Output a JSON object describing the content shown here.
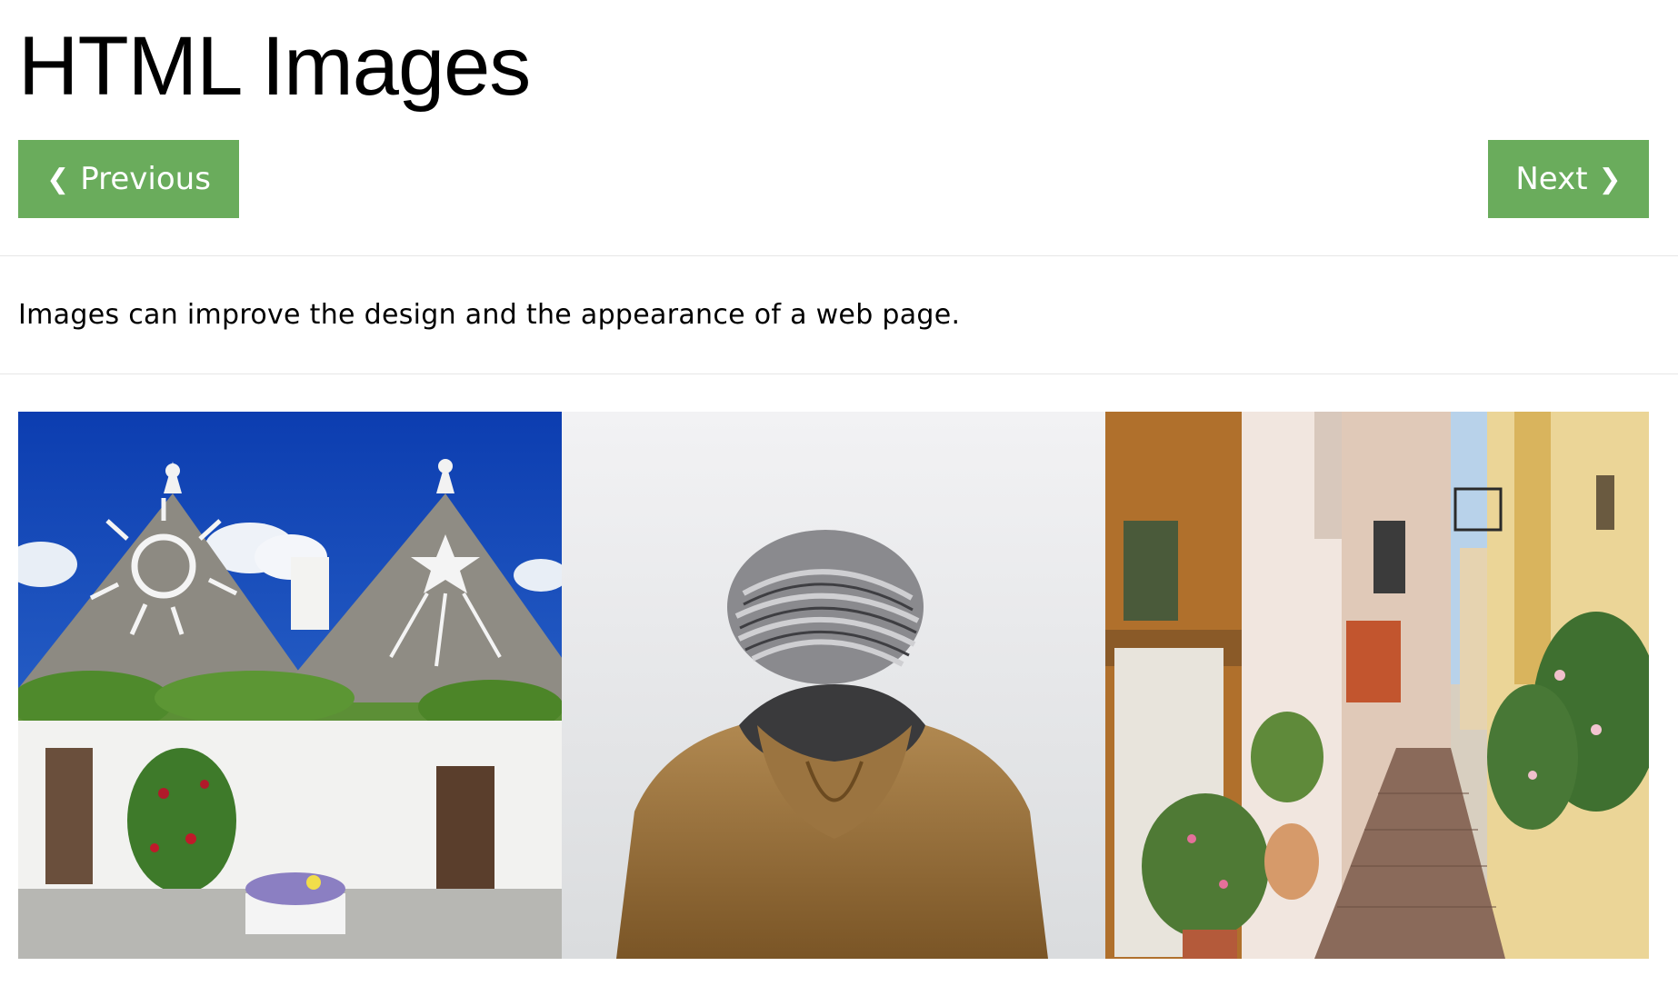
{
  "page": {
    "title": "HTML Images",
    "intro": "Images can improve the design and the appearance of a web page."
  },
  "nav": {
    "previous_label": "Previous",
    "next_label": "Next",
    "previous_icon": "chevron-left-icon",
    "next_icon": "chevron-right-icon"
  },
  "colors": {
    "button_bg": "#6aac5c",
    "button_text": "#ffffff",
    "divider": "#e6e6e6"
  },
  "gallery": {
    "images": [
      {
        "subject": "trulli-houses-photo"
      },
      {
        "subject": "person-in-knit-hat-photo"
      },
      {
        "subject": "narrow-street-photo"
      }
    ]
  }
}
